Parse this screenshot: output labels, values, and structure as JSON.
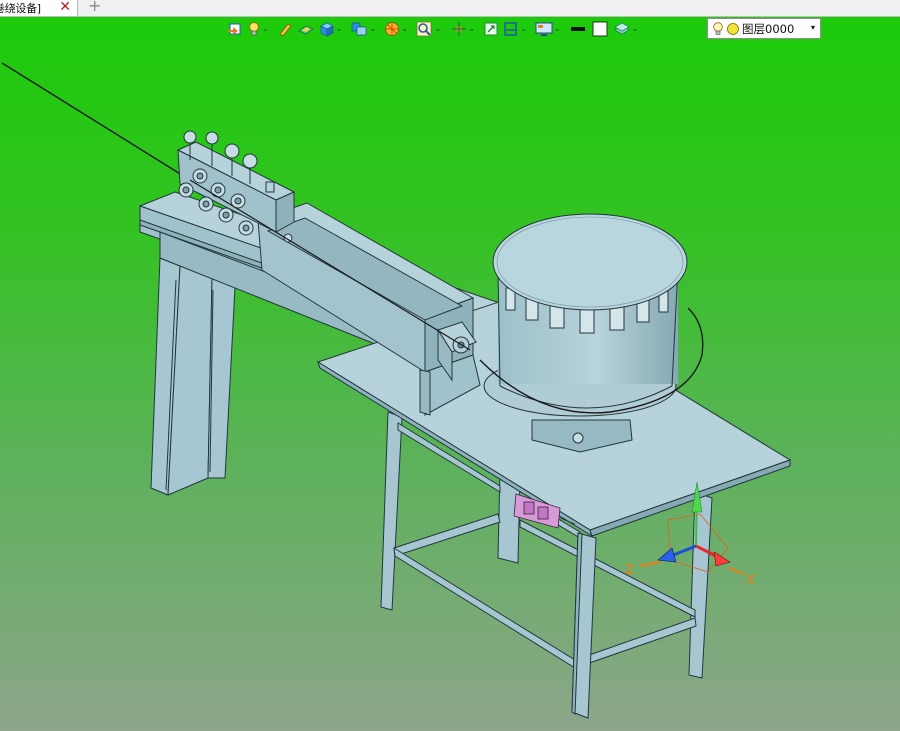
{
  "tab": {
    "title": "卷绕设备]",
    "close_glyph": "✕",
    "new_tab_glyph": "+"
  },
  "toolbar": {
    "items": [
      {
        "icon": "view-orient-icon",
        "dropdown": false
      },
      {
        "icon": "light-bulb-icon",
        "dropdown": true
      },
      {
        "icon": "pencil-icon",
        "dropdown": false
      },
      {
        "icon": "plane-icon",
        "dropdown": false
      },
      {
        "icon": "cube-icon",
        "dropdown": true
      },
      {
        "icon": "display-mode-icon",
        "dropdown": true
      },
      {
        "icon": "color-wheel-icon",
        "dropdown": true
      },
      {
        "icon": "zoom-icon",
        "dropdown": true
      },
      {
        "icon": "pan-icon",
        "dropdown": true
      },
      {
        "icon": "fit-view-icon",
        "dropdown": false
      },
      {
        "icon": "section-view-icon",
        "dropdown": true
      },
      {
        "icon": "monitor-icon",
        "dropdown": true
      },
      {
        "icon": "line-weight-icon",
        "dropdown": false
      },
      {
        "icon": "color-swatch-icon",
        "dropdown": false
      },
      {
        "icon": "layer-stack-icon",
        "dropdown": true
      }
    ],
    "dropdown_glyph": "⌄"
  },
  "layer": {
    "value": "图层0000",
    "arrow": "▾",
    "bulb_icon": "light-bulb-icon",
    "status_icon": "yellow-circle-icon"
  },
  "triad": {
    "x_label": "X",
    "z_label": "Z"
  },
  "colors": {
    "tab_close": "#b02020",
    "background_top": "#1ccb0a",
    "background_bottom": "#8da58a",
    "model_fill": "#a8c8d2",
    "axis_x": "#e8292b",
    "axis_y": "#38c23a",
    "axis_z": "#1f4ed8"
  }
}
